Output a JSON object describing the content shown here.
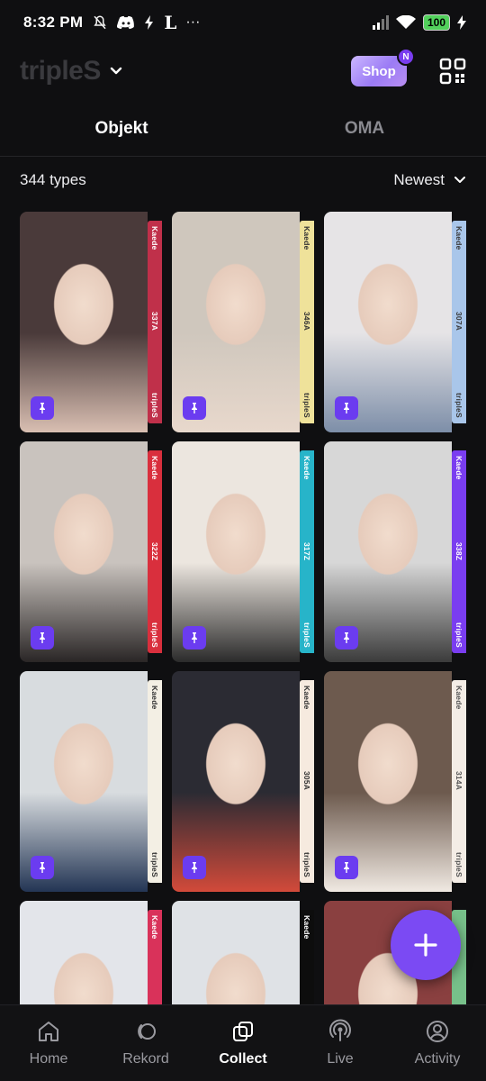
{
  "status_bar": {
    "time": "8:32 PM",
    "battery": "100",
    "extra_icon": "L",
    "more": "···"
  },
  "header": {
    "logo": "tripleS",
    "shop_label": "Shop",
    "shop_badge": "N"
  },
  "tabs": [
    {
      "label": "Objekt",
      "active": true
    },
    {
      "label": "OMA",
      "active": false
    }
  ],
  "filter": {
    "count": "344 types",
    "sort_label": "Newest"
  },
  "cards": [
    {
      "member": "Kaede",
      "code": "337A",
      "brand": "tripleS",
      "band_color": "#c0304a",
      "text_color": "#ffffff"
    },
    {
      "member": "Kaede",
      "code": "346A",
      "brand": "tripleS",
      "band_color": "#efe29a",
      "text_color": "#333333"
    },
    {
      "member": "Kaede",
      "code": "307A",
      "brand": "tripleS",
      "band_color": "#a9c6ea",
      "text_color": "#3a3a3a"
    },
    {
      "member": "Kaede",
      "code": "322Z",
      "brand": "tripleS",
      "band_color": "#d92f3d",
      "text_color": "#ffffff"
    },
    {
      "member": "Kaede",
      "code": "317Z",
      "brand": "tripleS",
      "band_color": "#27b4c9",
      "text_color": "#ffffff"
    },
    {
      "member": "Kaede",
      "code": "338Z",
      "brand": "tripleS",
      "band_color": "#7a3df0",
      "text_color": "#ffffff"
    },
    {
      "member": "Kaede",
      "code": "",
      "brand": "tripleS",
      "band_color": "#f3efe4",
      "text_color": "#333333"
    },
    {
      "member": "Kaede",
      "code": "305A",
      "brand": "tripleS",
      "band_color": "#f6eadf",
      "text_color": "#333333"
    },
    {
      "member": "Kaede",
      "code": "314A",
      "brand": "tripleS",
      "band_color": "#f4ede6",
      "text_color": "#555555"
    },
    {
      "member": "Kaede",
      "code": "",
      "brand": "",
      "band_color": "#d9325a",
      "text_color": "#ffffff"
    },
    {
      "member": "Kaede",
      "code": "",
      "brand": "",
      "band_color": "#0d0d0d",
      "text_color": "#ffffff"
    },
    {
      "member": "",
      "code": "",
      "brand": "",
      "band_color": "#77c08a",
      "text_color": "#ffffff"
    }
  ],
  "nav": [
    {
      "label": "Home",
      "icon": "home-icon"
    },
    {
      "label": "Rekord",
      "icon": "rekord-icon"
    },
    {
      "label": "Collect",
      "icon": "collect-icon",
      "active": true
    },
    {
      "label": "Live",
      "icon": "live-icon"
    },
    {
      "label": "Activity",
      "icon": "activity-icon"
    }
  ],
  "colors": {
    "accent": "#7b4af3",
    "background": "#0f0f11"
  }
}
